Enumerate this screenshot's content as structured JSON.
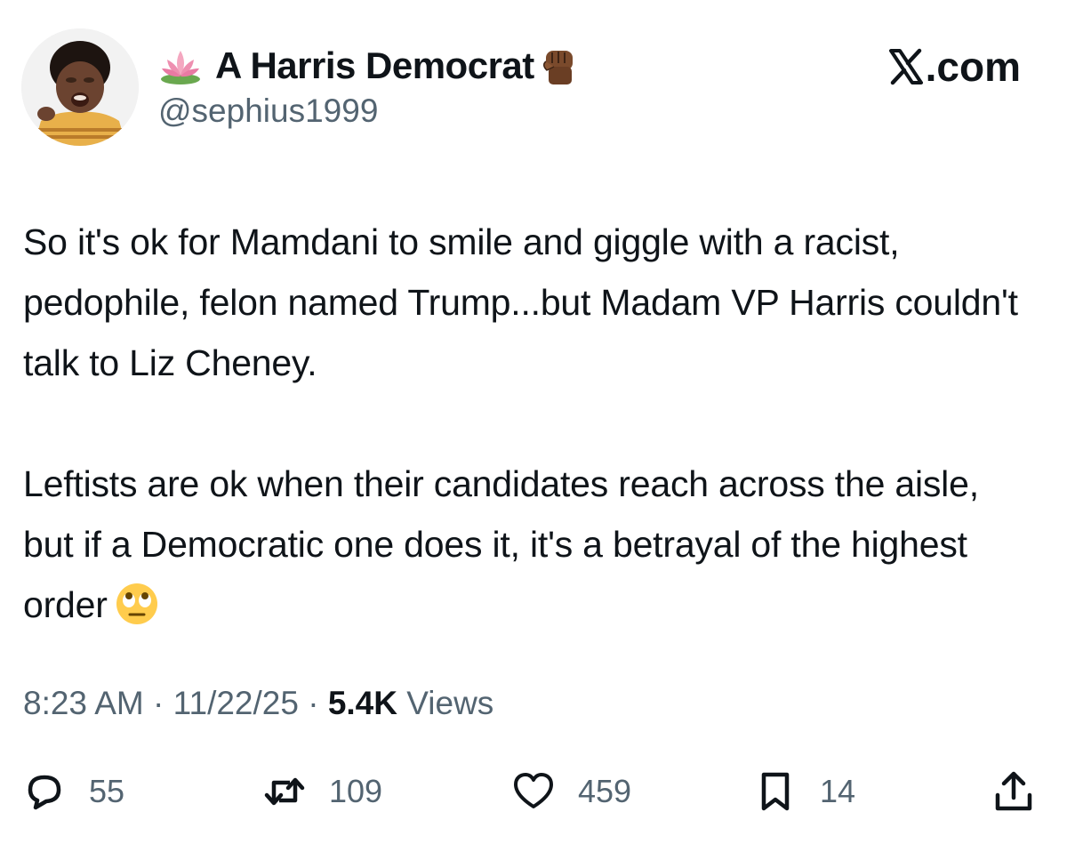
{
  "author": {
    "display_name": "A Harris Democrat",
    "handle": "@sephius1999",
    "name_prefix_icon": "lotus-icon",
    "name_suffix_icon": "raised-fist-icon"
  },
  "brand": {
    "label": ".com",
    "logo_icon": "x-logo-icon"
  },
  "tweet": {
    "paragraphs": [
      "So it's ok for Mamdani to smile and giggle with a racist, pedophile, felon named Trump...but Madam VP Harris couldn't talk to Liz Cheney.",
      "Leftists are ok when their candidates reach across the aisle, but if a Democratic one does it, it's a betrayal of the highest order"
    ],
    "trailing_emoji": "eye-roll-emoji"
  },
  "meta": {
    "time": "8:23 AM",
    "date": "11/22/25",
    "views_count": "5.4K",
    "views_label": "Views",
    "separator": "·"
  },
  "actions": {
    "reply": {
      "icon": "reply-icon",
      "count": "55"
    },
    "repost": {
      "icon": "repost-icon",
      "count": "109"
    },
    "like": {
      "icon": "heart-icon",
      "count": "459"
    },
    "bookmark": {
      "icon": "bookmark-icon",
      "count": "14"
    },
    "share": {
      "icon": "share-icon"
    }
  },
  "colors": {
    "text_primary": "#0f1419",
    "text_secondary": "#536471",
    "background": "#ffffff"
  }
}
